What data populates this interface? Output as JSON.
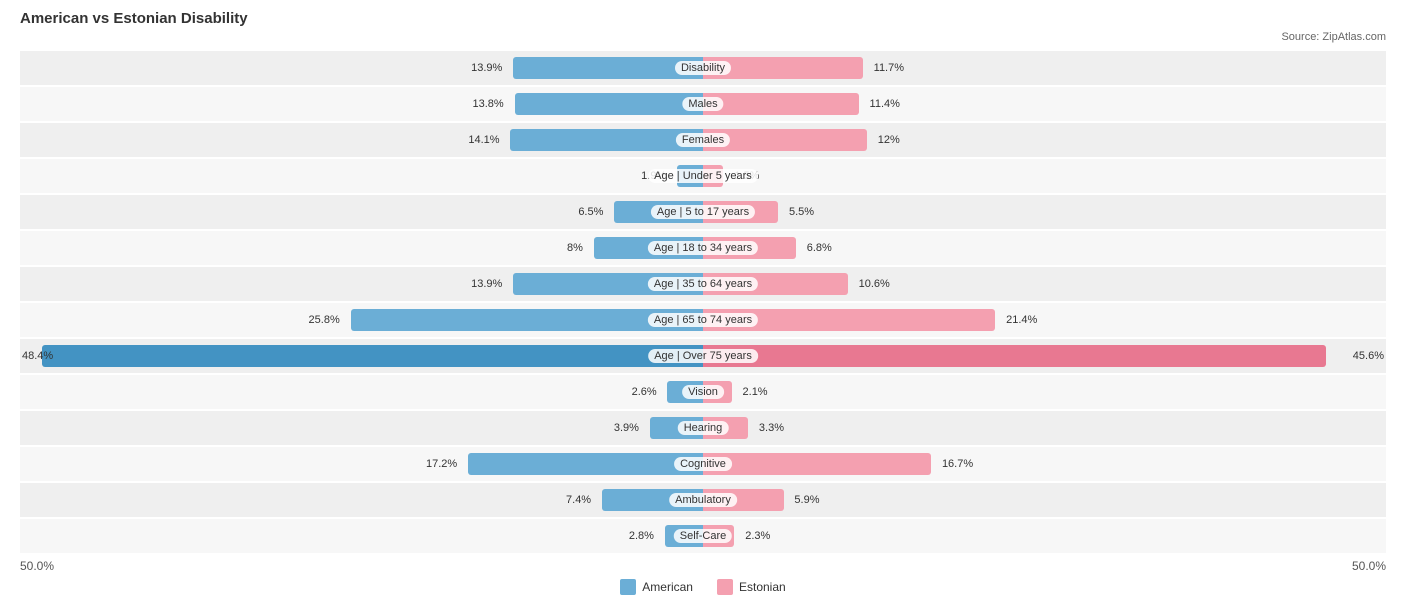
{
  "title": "American vs Estonian Disability",
  "source": "Source: ZipAtlas.com",
  "chart": {
    "max_pct": 50,
    "rows": [
      {
        "label": "Disability",
        "american": 13.9,
        "estonian": 11.7
      },
      {
        "label": "Males",
        "american": 13.8,
        "estonian": 11.4
      },
      {
        "label": "Females",
        "american": 14.1,
        "estonian": 12.0
      },
      {
        "label": "Age | Under 5 years",
        "american": 1.9,
        "estonian": 1.5
      },
      {
        "label": "Age | 5 to 17 years",
        "american": 6.5,
        "estonian": 5.5
      },
      {
        "label": "Age | 18 to 34 years",
        "american": 8.0,
        "estonian": 6.8
      },
      {
        "label": "Age | 35 to 64 years",
        "american": 13.9,
        "estonian": 10.6
      },
      {
        "label": "Age | 65 to 74 years",
        "american": 25.8,
        "estonian": 21.4
      },
      {
        "label": "Age | Over 75 years",
        "american": 48.4,
        "estonian": 45.6
      },
      {
        "label": "Vision",
        "american": 2.6,
        "estonian": 2.1
      },
      {
        "label": "Hearing",
        "american": 3.9,
        "estonian": 3.3
      },
      {
        "label": "Cognitive",
        "american": 17.2,
        "estonian": 16.7
      },
      {
        "label": "Ambulatory",
        "american": 7.4,
        "estonian": 5.9
      },
      {
        "label": "Self-Care",
        "american": 2.8,
        "estonian": 2.3
      }
    ]
  },
  "legend": {
    "american_label": "American",
    "estonian_label": "Estonian",
    "american_color": "#6baed6",
    "estonian_color": "#f4a0b0"
  },
  "axis": {
    "left": "50.0%",
    "right": "50.0%"
  }
}
